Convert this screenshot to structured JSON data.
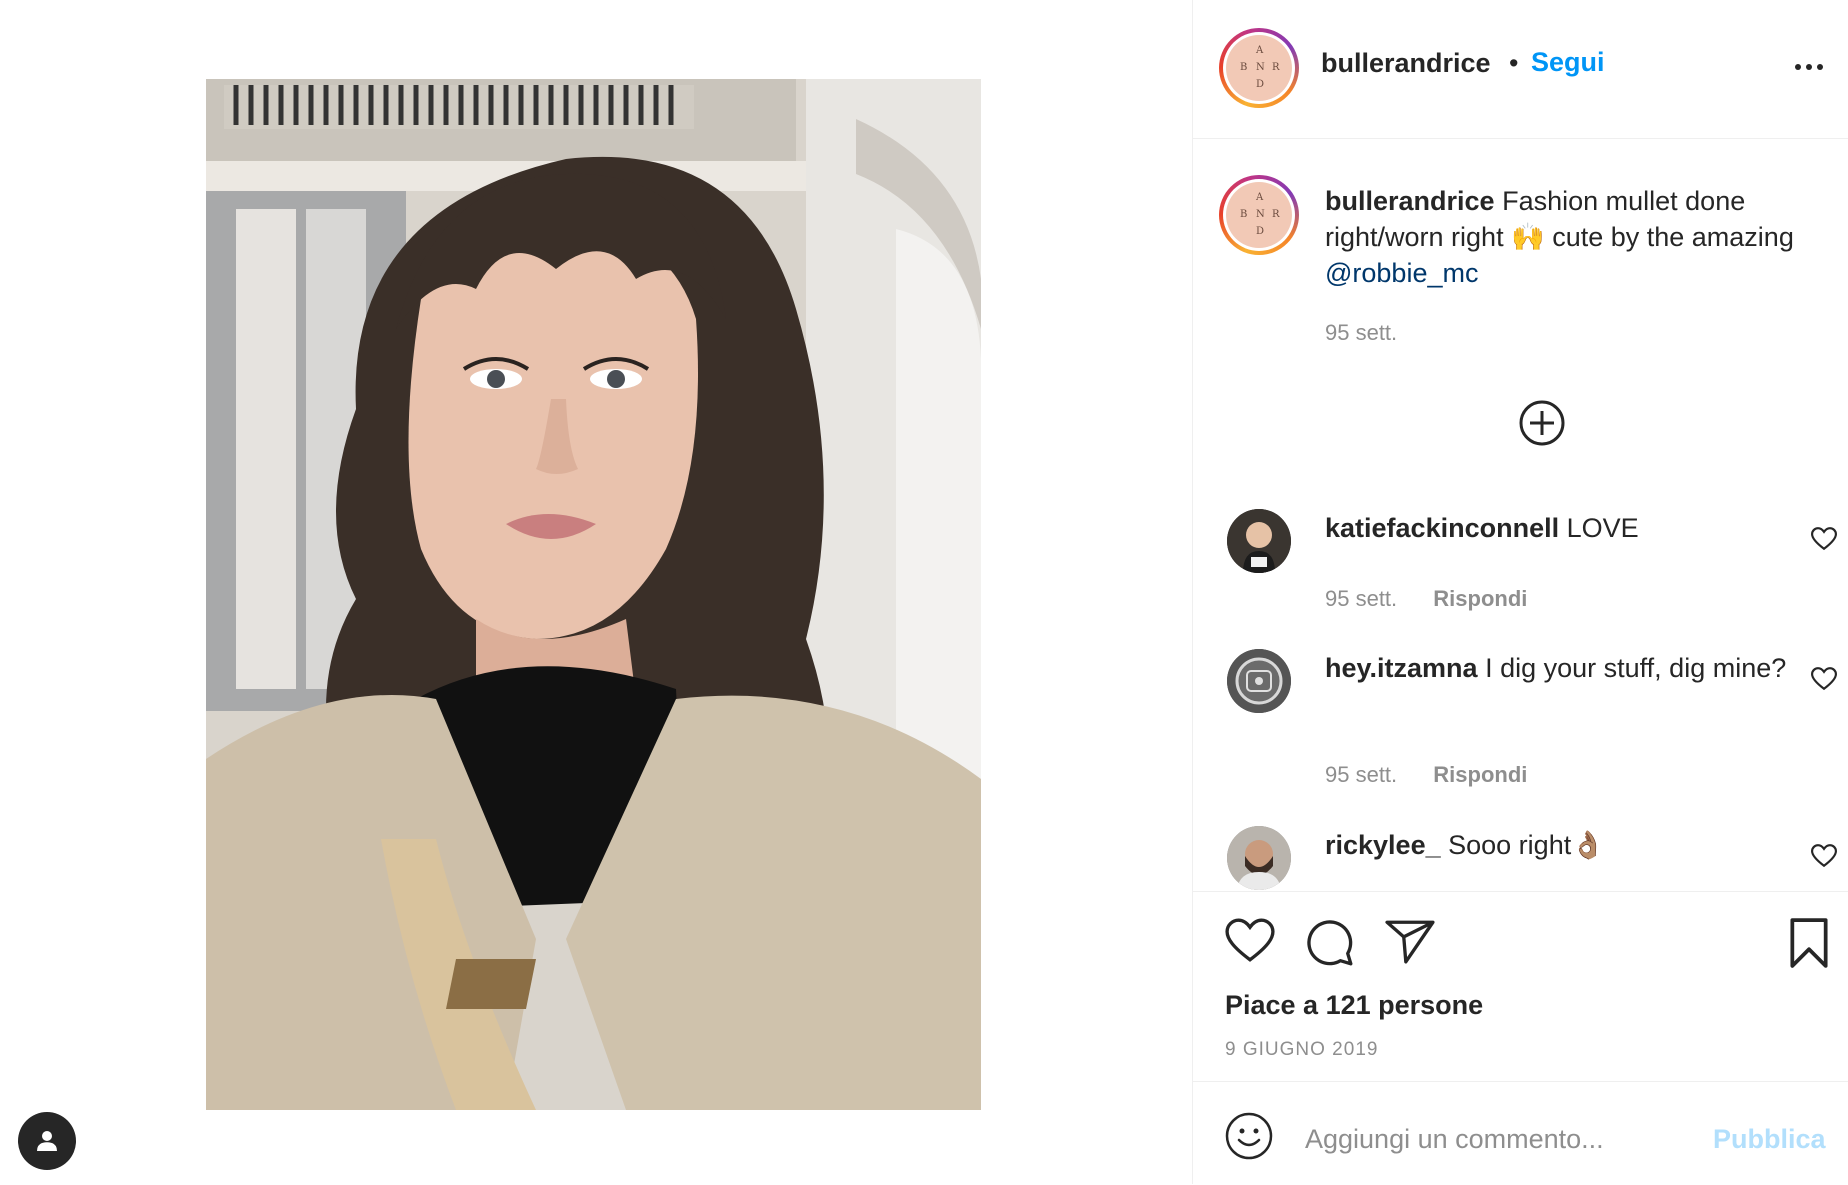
{
  "post": {
    "username": "bullerandrice",
    "follow_separator": "•",
    "follow_label": "Segui",
    "avatar_letters": [
      "A",
      "B",
      "N",
      "R",
      "D"
    ],
    "caption": {
      "username": "bullerandrice",
      "text": "Fashion mullet done right/worn right 🙌 cute by the amazing",
      "mention": "@robbie_mc",
      "time": "95 sett."
    },
    "load_more_icon": "plus-circle-icon",
    "comments": [
      {
        "username": "katiefackinconnell",
        "text": "LOVE",
        "time": "95 sett.",
        "reply": "Rispondi"
      },
      {
        "username": "hey.itzamna",
        "text": "I dig your stuff, dig mine?",
        "time": "95 sett.",
        "reply": "Rispondi"
      },
      {
        "username": "rickylee_",
        "text": "Sooo right👌🏽"
      }
    ],
    "likes": "Piace a 121 persone",
    "date": "9 GIUGNO 2019",
    "comment_placeholder": "Aggiungi un commento...",
    "publish_label": "Pubblica"
  },
  "colors": {
    "link_blue": "#0095f6",
    "mention_blue": "#00376b",
    "publish_disabled": "#b2dffc",
    "muted": "#8e8e8e"
  }
}
